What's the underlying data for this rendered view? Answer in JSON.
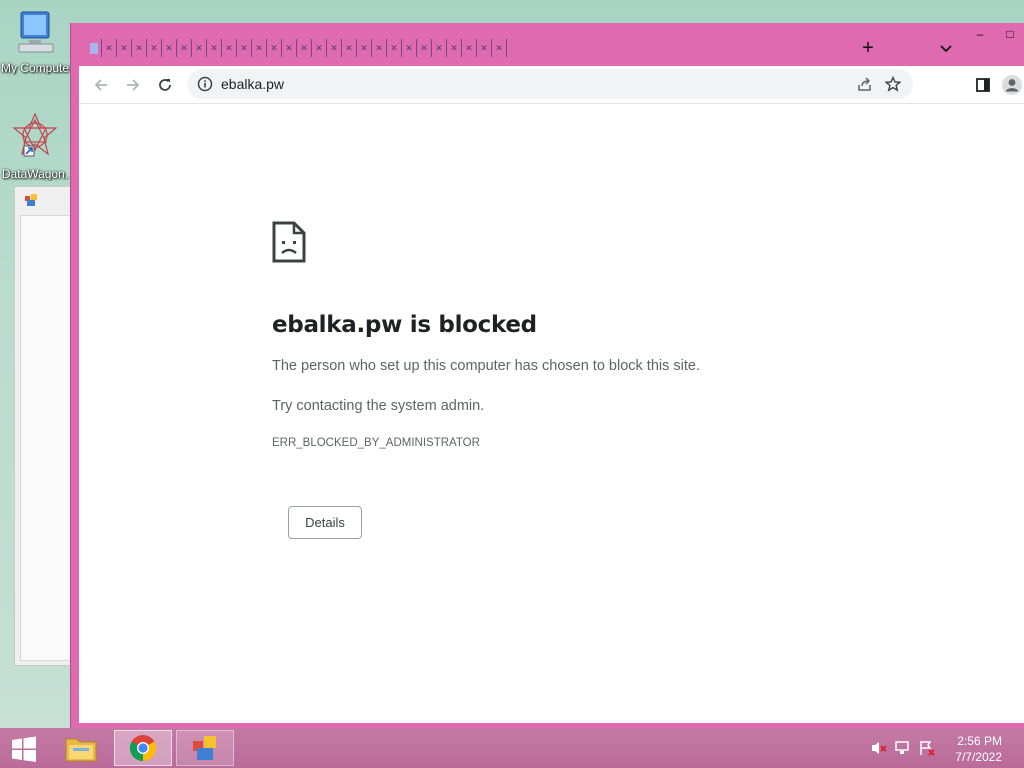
{
  "desktop": {
    "icons": [
      {
        "label": "My Compute"
      },
      {
        "label": "DataWagon."
      }
    ]
  },
  "browser": {
    "tabstrip": {
      "tab_count": 28,
      "new_tab": "+",
      "tab_search": "⌄"
    },
    "window_controls": {
      "minimize": "–",
      "maximize": "□"
    },
    "toolbar": {
      "url": "ebalka.pw"
    },
    "page": {
      "title": "ebalka.pw is blocked",
      "description": "The person who set up this computer has chosen to block this site.",
      "hint": "Try contacting the system admin.",
      "error_code": "ERR_BLOCKED_BY_ADMINISTRATOR",
      "details_label": "Details"
    }
  },
  "taskbar": {
    "time": "2:56 PM",
    "date": "7/7/2022"
  },
  "colors": {
    "frame": "#e06ab0",
    "taskbar": "#c57aa6",
    "desktop": "#b9dccf"
  }
}
